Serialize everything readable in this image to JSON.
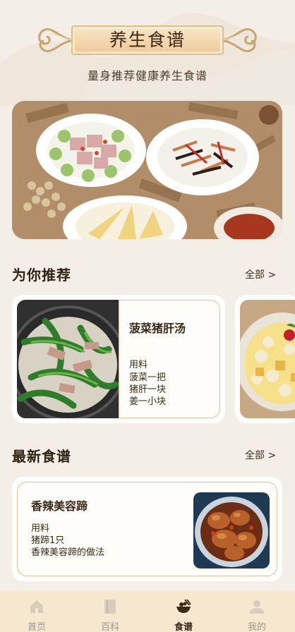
{
  "header": {
    "title": "养生食谱",
    "subtitle": "量身推荐健康养生食谱"
  },
  "hero": {
    "image": "herbal-dishes-spread"
  },
  "recommend": {
    "title": "为你推荐",
    "more": "全部 >",
    "items": [
      {
        "name": "菠菜猪肝汤",
        "ingredients_label": "用料",
        "ingredients": [
          "菠菜一把",
          "猪肝一块",
          "姜一小块"
        ],
        "image": "spinach-liver-soup"
      },
      {
        "image": "fruit-dessert-bowl"
      }
    ]
  },
  "latest": {
    "title": "最新食谱",
    "more": "全部 >",
    "items": [
      {
        "name": "香辣美容蹄",
        "ingredients_label": "用料",
        "ingredients": [
          "猪蹄1只",
          "香辣美容蹄的做法"
        ],
        "image": "braised-pork-trotters"
      }
    ]
  },
  "tabs": [
    {
      "label": "首页",
      "icon": "home-icon",
      "active": false
    },
    {
      "label": "百科",
      "icon": "book-icon",
      "active": false
    },
    {
      "label": "食谱",
      "icon": "bowl-icon",
      "active": true
    },
    {
      "label": "我的",
      "icon": "user-icon",
      "active": false
    }
  ],
  "colors": {
    "background": "#f4efe6",
    "banner_gold": "#eec99a",
    "card_border": "#d8c29d",
    "tabbar": "#f6e8cf",
    "text_dark": "#3a2918",
    "tab_inactive": "#9f9689"
  }
}
